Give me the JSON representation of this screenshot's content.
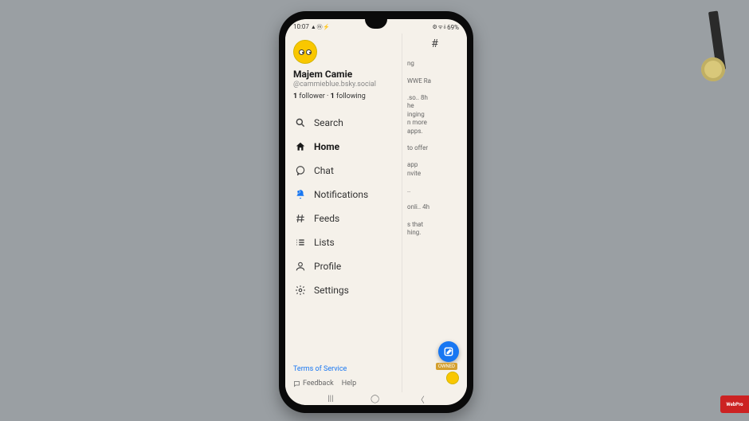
{
  "statusbar": {
    "time": "10:07",
    "left_icons": "▲ ⓜ ⚡",
    "right_icons": "⚙ ᯤ ⫰",
    "battery": "69%"
  },
  "profile": {
    "display_name": "Majem Camie",
    "handle": "@cammieblue.bsky.social",
    "followers_count": "1",
    "followers_label": "follower",
    "following_count": "1",
    "following_label": "following"
  },
  "nav": {
    "search": "Search",
    "home": "Home",
    "chat": "Chat",
    "notifications": "Notifications",
    "feeds": "Feeds",
    "lists": "Lists",
    "profile": "Profile",
    "settings": "Settings"
  },
  "footer": {
    "tos": "Terms of Service",
    "feedback": "Feedback",
    "help": "Help"
  },
  "peek": {
    "hash": "#",
    "line1": "ng",
    "line2": "WWE Ra",
    "block1": ".so.. 8h\nhe\ninging\nn more\napps.",
    "block2": "to offer",
    "block3": "app\nnvite",
    "block4": "..",
    "block5": "onli.. 4h",
    "block6": "s that\nhing.",
    "owned": "OWNED"
  },
  "watermark": "WebPro"
}
